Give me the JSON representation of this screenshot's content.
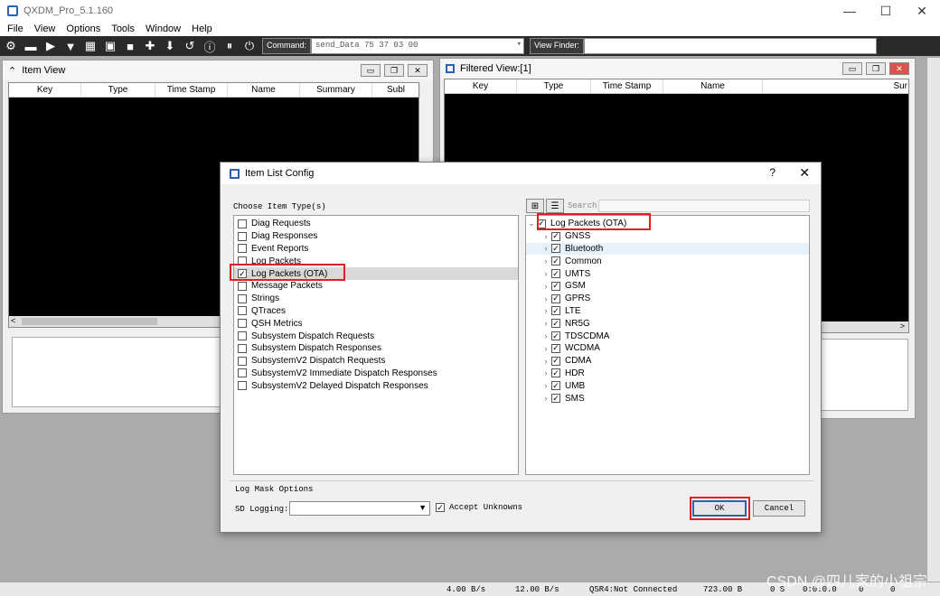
{
  "app": {
    "title": "QXDM_Pro_5.1.160",
    "win_min": "—",
    "win_max": "☐",
    "win_close": "✕"
  },
  "menu": [
    "File",
    "View",
    "Options",
    "Tools",
    "Window",
    "Help"
  ],
  "toolbar": {
    "command_label": "Command:",
    "command_value": "send_Data 75 37 03 00",
    "view_finder_label": "View Finder:"
  },
  "item_view": {
    "title": "Item View",
    "columns": [
      "Key",
      "Type",
      "Time Stamp",
      "Name",
      "Summary",
      "Subl"
    ]
  },
  "filtered_view": {
    "title": "Filtered View:[1]",
    "columns": [
      "Key",
      "Type",
      "Time Stamp",
      "Name",
      "Sur"
    ]
  },
  "dialog": {
    "title": "Item List Config",
    "help": "?",
    "close": "✕",
    "choose_label": "Choose Item Type(s)",
    "search_placeholder": "Search",
    "item_types": [
      {
        "label": "Diag Requests",
        "checked": false
      },
      {
        "label": "Diag Responses",
        "checked": false
      },
      {
        "label": "Event Reports",
        "checked": false
      },
      {
        "label": "Log Packets",
        "checked": false
      },
      {
        "label": "Log Packets (OTA)",
        "checked": true
      },
      {
        "label": "Message Packets",
        "checked": false
      },
      {
        "label": "Strings",
        "checked": false
      },
      {
        "label": "QTraces",
        "checked": false
      },
      {
        "label": "QSH Metrics",
        "checked": false
      },
      {
        "label": "Subsystem Dispatch Requests",
        "checked": false
      },
      {
        "label": "Subsystem Dispatch Responses",
        "checked": false
      },
      {
        "label": "SubsystemV2 Dispatch Requests",
        "checked": false
      },
      {
        "label": "SubsystemV2 Immediate Dispatch Responses",
        "checked": false
      },
      {
        "label": "SubsystemV2 Delayed Dispatch Responses",
        "checked": false
      }
    ],
    "tree_root": "Log Packets (OTA)",
    "tree_children": [
      "GNSS",
      "Bluetooth",
      "Common",
      "UMTS",
      "GSM",
      "GPRS",
      "LTE",
      "NR5G",
      "TDSCDMA",
      "WCDMA",
      "CDMA",
      "HDR",
      "UMB",
      "SMS"
    ],
    "log_mask_label": "Log Mask Options",
    "sd_logging_label": "SD Logging:",
    "accept_unknowns_label": "Accept Unknowns",
    "ok_label": "OK",
    "cancel_label": "Cancel"
  },
  "status": {
    "rate1": "4.00 B/s",
    "rate2": "12.00 B/s",
    "connection": "QSR4:Not Connected",
    "size": "723.00 B",
    "seconds": "0 S",
    "time": "0:0:0.0",
    "c1": "0",
    "c2": "0"
  },
  "watermark": "CSDN @四儿家的小祖宗"
}
